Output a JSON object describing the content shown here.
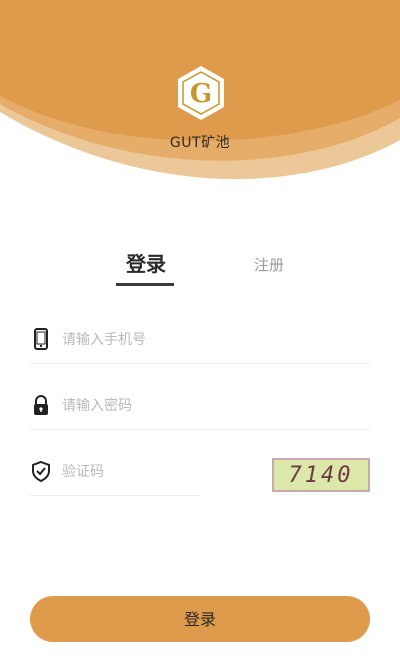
{
  "app": {
    "name": "GUT矿池",
    "logo_letter": "G"
  },
  "tabs": {
    "login": "登录",
    "register": "注册",
    "active": "login"
  },
  "form": {
    "phone": {
      "placeholder": "请输入手机号",
      "value": "",
      "icon": "phone-icon"
    },
    "password": {
      "placeholder": "请输入密码",
      "value": "",
      "icon": "lock-icon"
    },
    "captcha": {
      "placeholder": "验证码",
      "value": "",
      "icon": "shield-check-icon",
      "image_text": "7140"
    }
  },
  "submit_label": "登录",
  "colors": {
    "brand": "#de9b4c",
    "brand_light": "#e8b97c",
    "background": "#ffffff",
    "placeholder": "#b9b9b9"
  }
}
